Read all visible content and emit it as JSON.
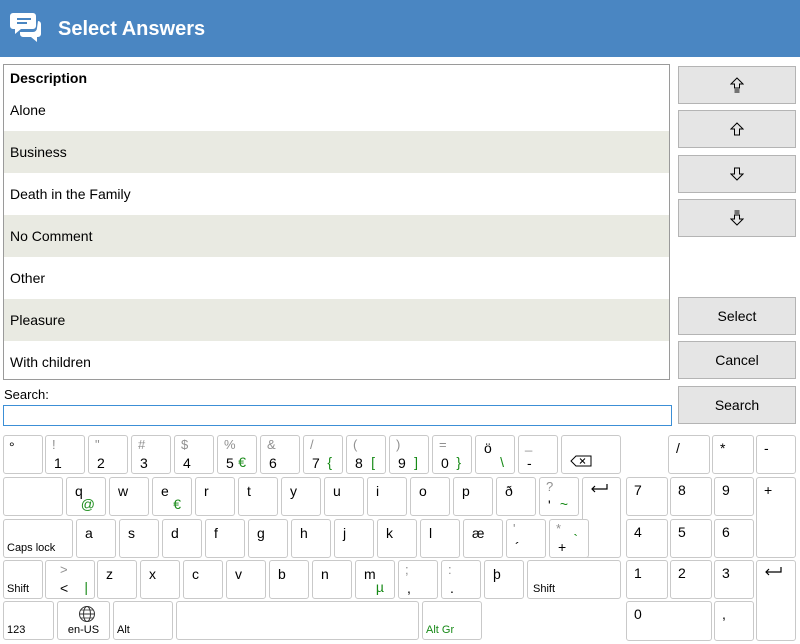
{
  "app": {
    "title": "Select Answers",
    "icon": "chat-bubbles-icon"
  },
  "list": {
    "header": "Description",
    "items": [
      "Alone",
      "Business",
      "Death in the Family",
      "No Comment",
      "Other",
      "Pleasure",
      "With children"
    ]
  },
  "side_buttons": {
    "move_top_icon": "move-to-top-icon",
    "move_up_icon": "move-up-icon",
    "move_down_icon": "move-down-icon",
    "move_bottom_icon": "move-to-bottom-icon",
    "select": "Select",
    "cancel": "Cancel",
    "search": "Search"
  },
  "search": {
    "label": "Search:",
    "value": "",
    "placeholder": ""
  },
  "keyboard": {
    "row1": [
      {
        "main": "°",
        "shift": "",
        "alt": ""
      },
      {
        "main": "1",
        "shift": "!",
        "alt": ""
      },
      {
        "main": "2",
        "shift": "\"",
        "alt": ""
      },
      {
        "main": "3",
        "shift": "#",
        "alt": ""
      },
      {
        "main": "4",
        "shift": "$",
        "alt": ""
      },
      {
        "main": "5",
        "shift": "%",
        "alt": "€"
      },
      {
        "main": "6",
        "shift": "&",
        "alt": ""
      },
      {
        "main": "7",
        "shift": "/",
        "alt": "{"
      },
      {
        "main": "8",
        "shift": "(",
        "alt": "["
      },
      {
        "main": "9",
        "shift": ")",
        "alt": "]"
      },
      {
        "main": "0",
        "shift": "=",
        "alt": "}"
      },
      {
        "main": "ö",
        "shift": "",
        "alt": "\\"
      },
      {
        "main": "-",
        "shift": "_",
        "alt": ""
      }
    ],
    "backspace_icon": "backspace-icon",
    "row2": [
      {
        "main": "q",
        "shift": "",
        "alt": "@"
      },
      {
        "main": "w",
        "shift": "",
        "alt": ""
      },
      {
        "main": "e",
        "shift": "",
        "alt": "€"
      },
      {
        "main": "r",
        "shift": "",
        "alt": ""
      },
      {
        "main": "t",
        "shift": "",
        "alt": ""
      },
      {
        "main": "y",
        "shift": "",
        "alt": ""
      },
      {
        "main": "u",
        "shift": "",
        "alt": ""
      },
      {
        "main": "i",
        "shift": "",
        "alt": ""
      },
      {
        "main": "o",
        "shift": "",
        "alt": ""
      },
      {
        "main": "p",
        "shift": "",
        "alt": ""
      },
      {
        "main": "ð",
        "shift": "",
        "alt": ""
      },
      {
        "main": "'",
        "shift": "?",
        "alt": "~"
      }
    ],
    "enter_icon": "enter-icon",
    "caps_lock": "Caps lock",
    "row3": [
      {
        "main": "a",
        "shift": "",
        "alt": ""
      },
      {
        "main": "s",
        "shift": "",
        "alt": ""
      },
      {
        "main": "d",
        "shift": "",
        "alt": ""
      },
      {
        "main": "f",
        "shift": "",
        "alt": ""
      },
      {
        "main": "g",
        "shift": "",
        "alt": ""
      },
      {
        "main": "h",
        "shift": "",
        "alt": ""
      },
      {
        "main": "j",
        "shift": "",
        "alt": ""
      },
      {
        "main": "k",
        "shift": "",
        "alt": ""
      },
      {
        "main": "l",
        "shift": "",
        "alt": ""
      },
      {
        "main": "æ",
        "shift": "",
        "alt": ""
      },
      {
        "main": "´",
        "shift": "'",
        "alt": ""
      },
      {
        "main": "+",
        "shift": "*",
        "alt": "`"
      }
    ],
    "shift_left": "Shift",
    "row4": [
      {
        "main": "<",
        "shift": ">",
        "alt": "|"
      },
      {
        "main": "z",
        "shift": "",
        "alt": ""
      },
      {
        "main": "x",
        "shift": "",
        "alt": ""
      },
      {
        "main": "c",
        "shift": "",
        "alt": ""
      },
      {
        "main": "v",
        "shift": "",
        "alt": ""
      },
      {
        "main": "b",
        "shift": "",
        "alt": ""
      },
      {
        "main": "n",
        "shift": "",
        "alt": ""
      },
      {
        "main": "m",
        "shift": "",
        "alt": "µ"
      },
      {
        "main": ",",
        "shift": ";",
        "alt": ""
      },
      {
        "main": ".",
        "shift": ":",
        "alt": ""
      },
      {
        "main": "þ",
        "shift": "",
        "alt": ""
      }
    ],
    "shift_right": "Shift",
    "key_123": "123",
    "language": "en-US",
    "globe_icon": "globe-icon",
    "alt": "Alt",
    "alt_gr": "Alt Gr",
    "numpad": [
      "/",
      "*",
      "-",
      "7",
      "8",
      "9",
      "+",
      "4",
      "5",
      "6",
      "1",
      "2",
      "3",
      "0",
      ","
    ],
    "numpad_enter_icon": "enter-icon"
  },
  "colors": {
    "title_bar": "#4a86c2",
    "list_alt_row": "#e9eae2",
    "alt_gr_green": "#178a17",
    "search_border": "#3c8fd6"
  }
}
